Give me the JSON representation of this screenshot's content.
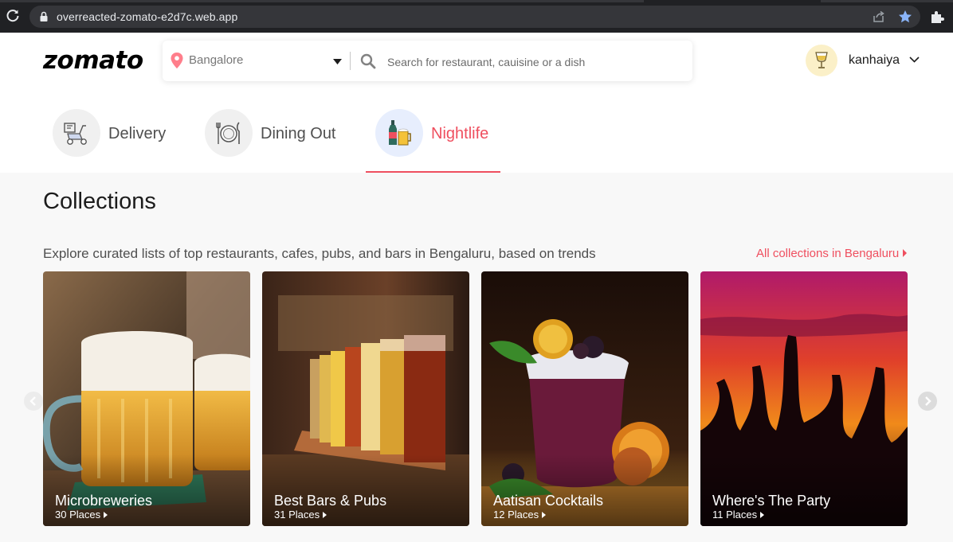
{
  "browser": {
    "url": "overreacted-zomato-e2d7c.web.app"
  },
  "header": {
    "logo": "zomato",
    "location": "Bangalore",
    "search_placeholder": "Search for restaurant, cauisine or a dish",
    "username": "kanhaiya"
  },
  "tabs": [
    {
      "label": "Delivery",
      "icon": "delivery-scooter-icon"
    },
    {
      "label": "Dining Out",
      "icon": "dining-plate-icon"
    },
    {
      "label": "Nightlife",
      "icon": "nightlife-drinks-icon",
      "active": true
    }
  ],
  "collections": {
    "title": "Collections",
    "subtitle": "Explore curated lists of top restaurants, cafes, pubs, and bars in Bengaluru, based on trends",
    "all_link": "All collections in Bengaluru",
    "cards": [
      {
        "title": "Microbreweries",
        "places": "30 Places"
      },
      {
        "title": "Best Bars & Pubs",
        "places": "31 Places"
      },
      {
        "title": "Aatisan Cocktails",
        "places": "12 Places"
      },
      {
        "title": "Where's The Party",
        "places": "11 Places"
      }
    ]
  },
  "colors": {
    "accent": "#ef4f5f",
    "chrome": "#202124",
    "star": "#8ab4f8"
  }
}
